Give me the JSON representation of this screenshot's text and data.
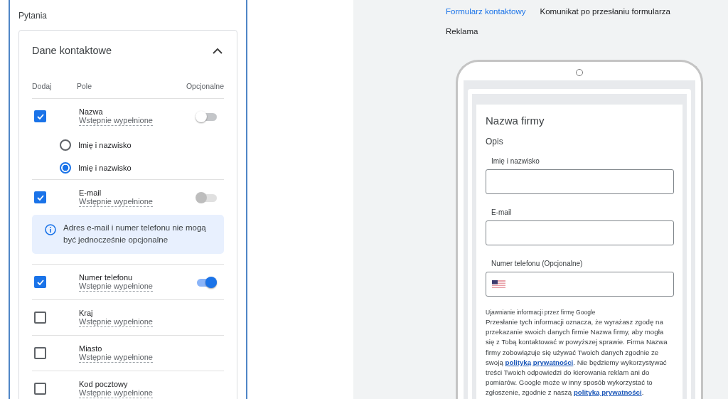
{
  "panel": {
    "title": "Pytania"
  },
  "section": {
    "title": "Dane kontaktowe",
    "expanded": true,
    "columns": [
      "Dodaj",
      "Pole",
      "Opcjonalne"
    ],
    "fields": [
      {
        "name": "Nazwa",
        "note": "Wstępnie wypełnione",
        "checked": true,
        "optional": {
          "on": false,
          "disabled": false
        },
        "options": [
          {
            "label": "Imię i nazwisko",
            "selected": false
          },
          {
            "label": "Imię i nazwisko",
            "selected": true
          }
        ]
      },
      {
        "name": "E-mail",
        "note": "Wstępnie wypełnione",
        "checked": true,
        "optional": {
          "on": false,
          "disabled": true
        },
        "info": "Adres e-mail i numer telefonu nie mogą być jednocześnie opcjonalne"
      },
      {
        "name": "Numer telefonu",
        "note": "Wstępnie wypełnione",
        "checked": true,
        "optional": {
          "on": true,
          "disabled": false
        }
      },
      {
        "name": "Kraj",
        "note": "Wstępnie wypełnione",
        "checked": false
      },
      {
        "name": "Miasto",
        "note": "Wstępnie wypełnione",
        "checked": false
      },
      {
        "name": "Kod pocztowy",
        "note": "Wstępnie wypełnione",
        "checked": false
      }
    ]
  },
  "preview": {
    "tabs": [
      {
        "label": "Formularz kontaktowy",
        "selected": true
      },
      {
        "label": "Komunikat po przesłaniu formularza",
        "selected": false
      },
      {
        "label": "Reklama",
        "selected": false
      }
    ],
    "form": {
      "title": "Nazwa firmy",
      "description": "Opis",
      "inputs": [
        {
          "label": "Imię i nazwisko",
          "kind": "text"
        },
        {
          "label": "E-mail",
          "kind": "text"
        },
        {
          "label": "Numer telefonu (Opcjonalne)",
          "kind": "phone"
        }
      ],
      "disclosure_title": "Ujawnianie informacji przez firmę Google",
      "disclosure": [
        {
          "kind": "text",
          "text": "Przesłanie tych informacji oznacza, że wyrażasz zgodę na przekazanie swoich danych firmie Nazwa firmy, aby mogła się z Tobą kontaktować w powyższej sprawie. Firma Nazwa firmy zobowiązuje się używać Twoich danych zgodnie ze swoją "
        },
        {
          "kind": "link",
          "text": "polityką prywatności"
        },
        {
          "kind": "text",
          "text": ". Nie będziemy wykorzystywać treści Twoich odpowiedzi do kierowania reklam ani do pomiarów. Google może w inny sposób wykorzystać to zgłoszenie, zgodnie z naszą "
        },
        {
          "kind": "link",
          "text": "polityką prywatności"
        },
        {
          "kind": "text",
          "text": "."
        }
      ]
    }
  }
}
